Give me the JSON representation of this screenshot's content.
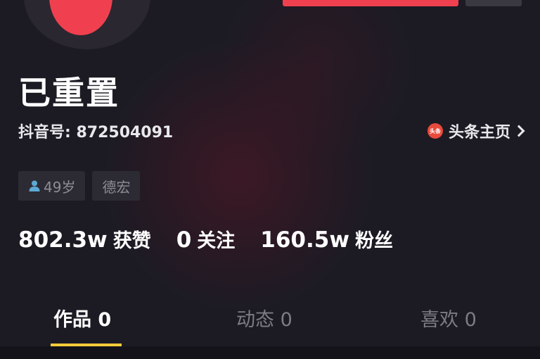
{
  "profile": {
    "nickname": "已重置",
    "douyin_id": "抖音号: 872504091",
    "toutiao_label": "头条主页",
    "toutiao_icon_text": "头条"
  },
  "tags": [
    {
      "label": "49岁",
      "icon": "person-icon"
    },
    {
      "label": "德宏"
    }
  ],
  "stats": [
    {
      "value": "802.3w",
      "label": "获赞"
    },
    {
      "value": "0",
      "label": "关注"
    },
    {
      "value": "160.5w",
      "label": "粉丝"
    }
  ],
  "tabs": [
    {
      "label": "作品 0",
      "active": true
    },
    {
      "label": "动态 0",
      "active": false
    },
    {
      "label": "喜欢 0",
      "active": false
    }
  ],
  "colors": {
    "accent_red": "#f0404f",
    "tab_indicator": "#facc3a",
    "background": "#1c1b24"
  }
}
